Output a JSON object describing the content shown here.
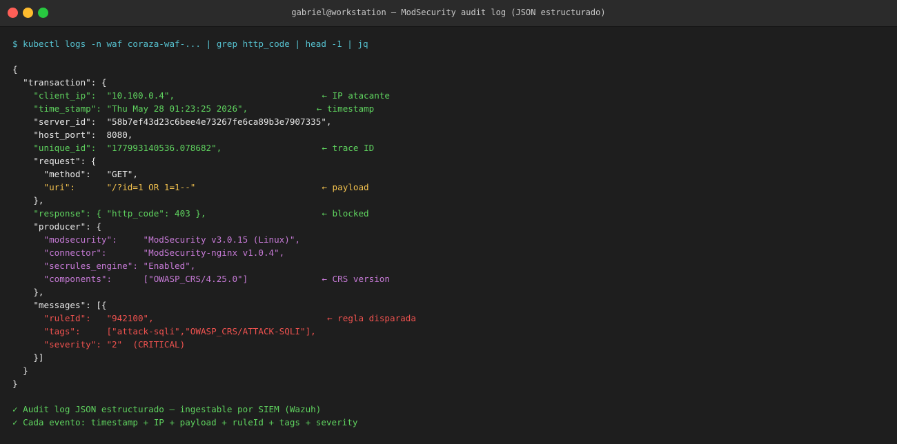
{
  "window": {
    "title": "gabriel@workstation — ModSecurity audit log (JSON estructurado)",
    "traffic_colors": {
      "close": "#ff5f57",
      "minimize": "#febc2e",
      "zoom": "#28c840"
    }
  },
  "terminal": {
    "command": "$ kubectl logs -n waf coraza-waf-... | grep http_code | head -1 | jq",
    "json_lines": [
      {
        "text": "{",
        "color": "w"
      },
      {
        "text": "  \"transaction\": {",
        "color": "w"
      },
      {
        "text": "    \"client_ip\":  \"10.100.0.4\",",
        "color": "g",
        "annotation": "← IP atacante",
        "ann_col": 59
      },
      {
        "text": "    \"time_stamp\": \"Thu May 28 01:23:25 2026\",",
        "color": "g",
        "annotation": "← timestamp",
        "ann_col": 58
      },
      {
        "text": "    \"server_id\":  \"58b7ef43d23c6bee4e73267fe6ca89b3e7907335\",",
        "color": "w"
      },
      {
        "text": "    \"host_port\":  8080,",
        "color": "w"
      },
      {
        "text": "    \"unique_id\":  \"177993140536.078682\",",
        "color": "g",
        "annotation": "← trace ID",
        "ann_col": 59
      },
      {
        "text": "    \"request\": {",
        "color": "w"
      },
      {
        "text": "      \"method\":   \"GET\",",
        "color": "w"
      },
      {
        "text": "      \"uri\":      \"/?id=1 OR 1=1--\"",
        "color": "o",
        "annotation": "← payload",
        "ann_col": 59
      },
      {
        "text": "    },",
        "color": "w"
      },
      {
        "text": "    \"response\": { \"http_code\": 403 },",
        "color": "g",
        "annotation": "← blocked",
        "ann_col": 59
      },
      {
        "text": "    \"producer\": {",
        "color": "w"
      },
      {
        "text": "      \"modsecurity\":     \"ModSecurity v3.0.15 (Linux)\",",
        "color": "p"
      },
      {
        "text": "      \"connector\":       \"ModSecurity-nginx v1.0.4\",",
        "color": "p"
      },
      {
        "text": "      \"secrules_engine\": \"Enabled\",",
        "color": "p"
      },
      {
        "text": "      \"components\":      [\"OWASP_CRS/4.25.0\"]",
        "color": "p",
        "annotation": "← CRS version",
        "ann_col": 59
      },
      {
        "text": "    },",
        "color": "w"
      },
      {
        "text": "    \"messages\": [{",
        "color": "w"
      },
      {
        "text": "      \"ruleId\":   \"942100\",",
        "color": "r",
        "annotation": "← regla disparada",
        "ann_col": 60
      },
      {
        "text": "      \"tags\":     [\"attack-sqli\",\"OWASP_CRS/ATTACK-SQLI\"],",
        "color": "r"
      },
      {
        "text": "      \"severity\": \"2\"  (CRITICAL)",
        "color": "r"
      },
      {
        "text": "    }]",
        "color": "w"
      },
      {
        "text": "  }",
        "color": "w"
      },
      {
        "text": "}",
        "color": "w"
      }
    ],
    "summary_lines": [
      "✓ Audit log JSON estructurado — ingestable por SIEM (Wazuh)",
      "✓ Cada evento: timestamp + IP + payload + ruleId + tags + severity"
    ]
  }
}
